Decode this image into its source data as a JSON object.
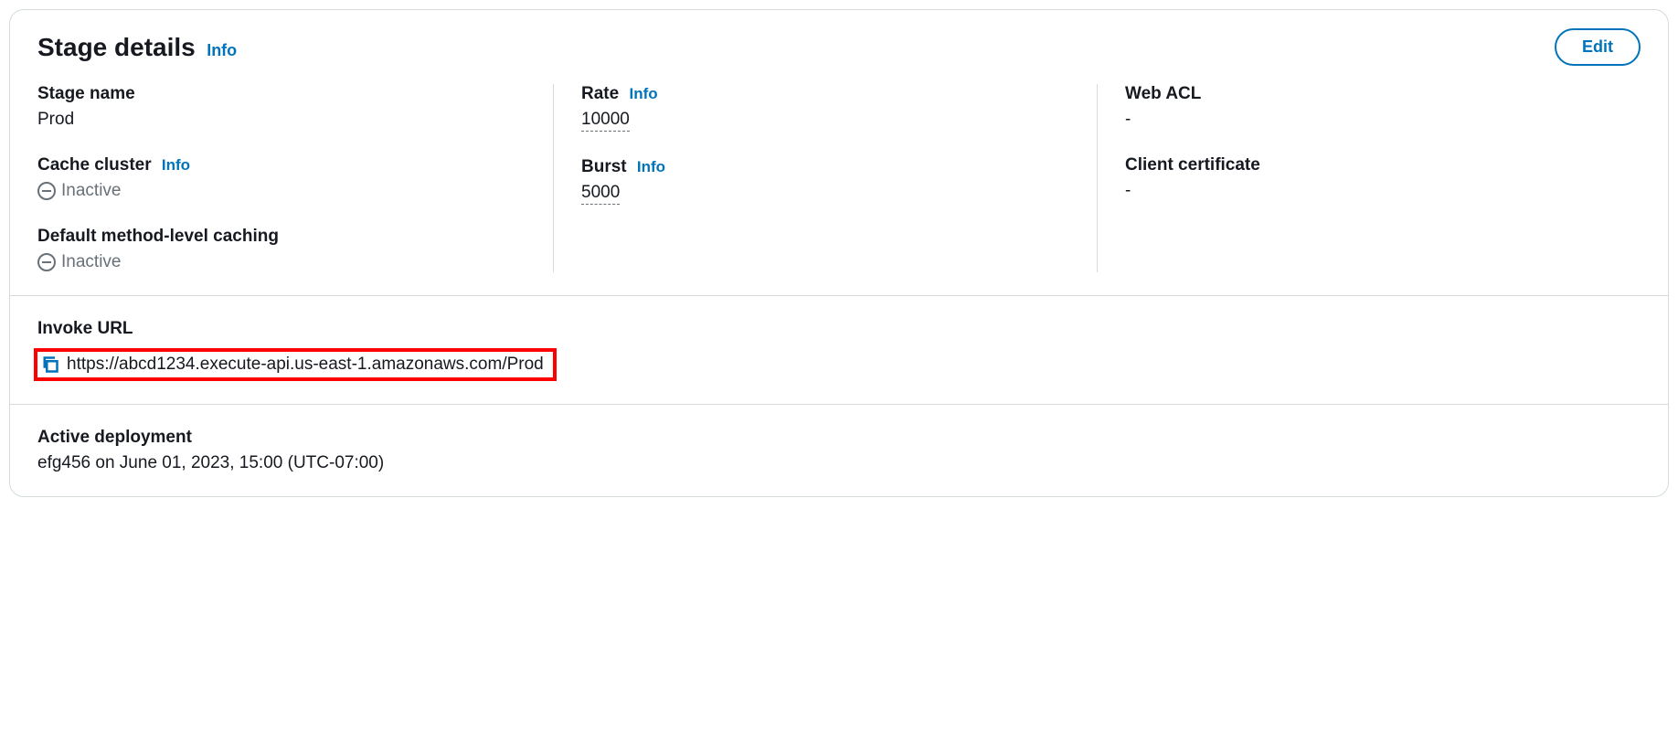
{
  "header": {
    "title": "Stage details",
    "info_label": "Info",
    "edit_label": "Edit"
  },
  "col1": {
    "stage_name": {
      "label": "Stage name",
      "value": "Prod"
    },
    "cache_cluster": {
      "label": "Cache cluster",
      "info_label": "Info",
      "status": "Inactive"
    },
    "default_caching": {
      "label": "Default method-level caching",
      "status": "Inactive"
    }
  },
  "col2": {
    "rate": {
      "label": "Rate",
      "info_label": "Info",
      "value": "10000"
    },
    "burst": {
      "label": "Burst",
      "info_label": "Info",
      "value": "5000"
    }
  },
  "col3": {
    "web_acl": {
      "label": "Web ACL",
      "value": "-"
    },
    "client_cert": {
      "label": "Client certificate",
      "value": "-"
    }
  },
  "invoke": {
    "label": "Invoke URL",
    "url": "https://abcd1234.execute-api.us-east-1.amazonaws.com/Prod"
  },
  "deployment": {
    "label": "Active deployment",
    "value": "efg456 on June 01, 2023, 15:00 (UTC-07:00)"
  }
}
